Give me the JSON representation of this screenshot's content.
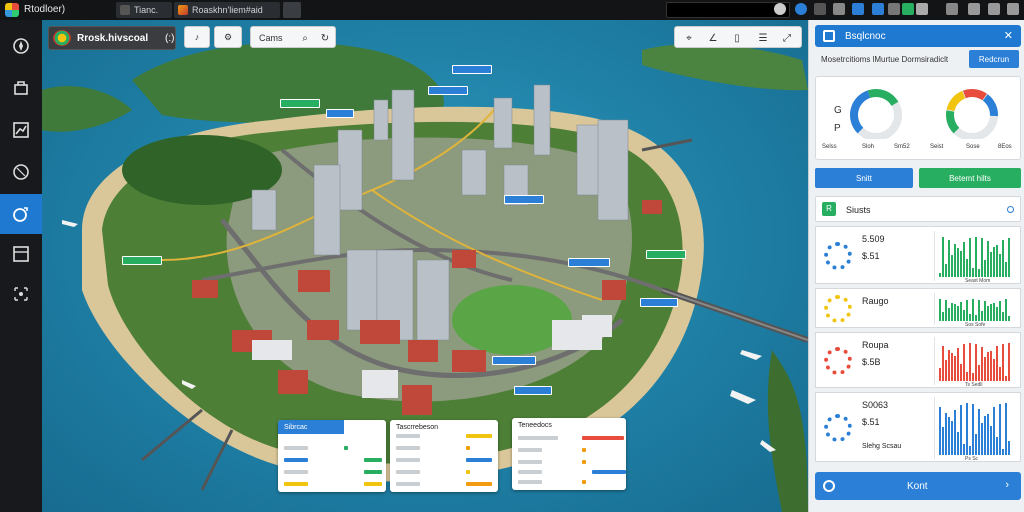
{
  "window": {
    "title": "Rtodloer)"
  },
  "tabs": [
    {
      "label": "Tianc."
    },
    {
      "label": "Roaskhn'liem#aid"
    }
  ],
  "rail": {
    "items": [
      {
        "icon": "compass-icon"
      },
      {
        "icon": "layers-icon"
      },
      {
        "icon": "chart-icon"
      },
      {
        "icon": "circle-icon"
      },
      {
        "icon": "globe-icon",
        "active": true
      },
      {
        "icon": "panel-icon"
      },
      {
        "icon": "grid-icon"
      }
    ]
  },
  "map": {
    "title": "Rrosk.hivscoal",
    "title_suffix": "(:)",
    "zoom_label": "Cams",
    "colors": {
      "water": "#1f7fa5",
      "land": "#3d6e2f",
      "road": "#6e6e6e",
      "route": "#e0b43a"
    }
  },
  "cards": [
    {
      "title": "Sibrcac"
    },
    {
      "title": "Tascrrebeson"
    },
    {
      "title": "Teneedocs"
    }
  ],
  "panel": {
    "header_title": "Bsqlcnoc",
    "sub_label": "Mosetrcitioms lMurtue Dormsiradiclt",
    "sub_button": "Redcrun",
    "gauges": [
      {
        "left_labels": [
          "Selss",
          "Sloh",
          "Sm52"
        ],
        "level": 0.72,
        "side": [
          "G",
          "P"
        ],
        "colors": [
          "#2b7fd6",
          "#27ae60"
        ]
      },
      {
        "left_labels": [
          "Seist",
          "Sose",
          "8Eos"
        ],
        "level": 0.85,
        "colors": [
          "#27ae60",
          "#f1c40f",
          "#e74c3c",
          "#2b7fd6"
        ]
      }
    ],
    "button_left": "Snitt",
    "button_right": "Betemt hilts",
    "list_title": "Siusts",
    "stats": [
      {
        "value": "5.509",
        "sub": "$.51",
        "ring": "#2b7fd6",
        "bars": "#27ae60",
        "caption": "Seast Mom"
      },
      {
        "value": "Raugo",
        "sub": "",
        "ring": "#f1c40f",
        "bars": "#27ae60",
        "caption": "Sos Sofe"
      },
      {
        "value": "Roupa",
        "sub": "$.5B",
        "ring": "#e74c3c",
        "bars": "#e74c3c",
        "caption": "Ts Sedll"
      },
      {
        "value": "S0063",
        "sub": "$.51",
        "ring": "#2b7fd6",
        "bars": "#2b7fd6",
        "caption": "Ps Sc"
      }
    ],
    "stat_extra": "Slehg Scsau",
    "footer_label": "Kont"
  }
}
